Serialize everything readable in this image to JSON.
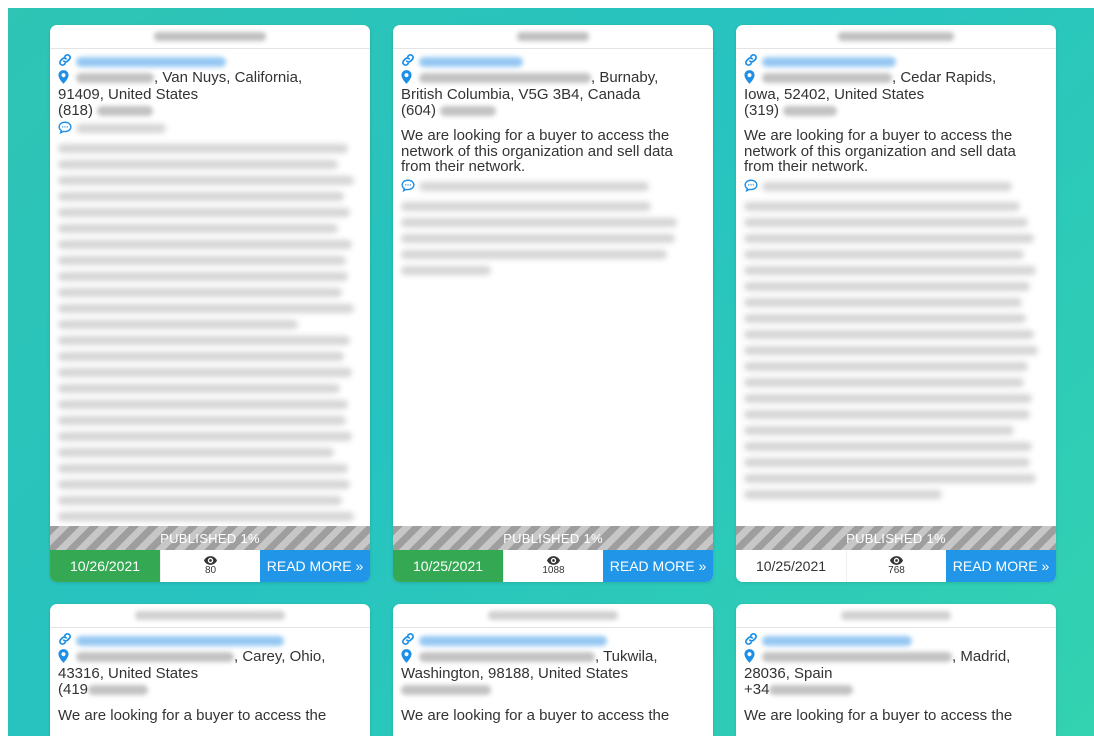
{
  "cards": [
    {
      "address_tail": ", Van Nuys, California,",
      "address_line2": "91409, United States",
      "phone_prefix": "(818)",
      "buyer_text": "",
      "status": "PUBLISHED 1%",
      "date": "10/26/2021",
      "views": "80",
      "read_more": "READ MORE »",
      "date_style": "green"
    },
    {
      "address_tail": ", Burnaby,",
      "address_line2": "British Columbia, V5G 3B4, Canada",
      "phone_prefix": "(604)",
      "buyer_text": "We are looking for a buyer to access the network of this organization and sell data from their network.",
      "status": "PUBLISHED 1%",
      "date": "10/25/2021",
      "views": "1088",
      "read_more": "READ MORE »",
      "date_style": "green"
    },
    {
      "address_tail": ", Cedar Rapids,",
      "address_line2": "Iowa, 52402, United States",
      "phone_prefix": "(319)",
      "buyer_text": "We are looking for a buyer to access the network of this organization and sell data from their network.",
      "status": "PUBLISHED 1%",
      "date": "10/25/2021",
      "views": "768",
      "read_more": "READ MORE »",
      "date_style": "plain"
    },
    {
      "address_tail": ", Carey, Ohio,",
      "address_line2": "43316, United States",
      "phone_prefix": "(419",
      "buyer_text": "We are looking for a buyer to access the"
    },
    {
      "address_tail": ", Tukwila,",
      "address_line2": "Washington, 98188, United States",
      "phone_prefix": "",
      "buyer_text": "We are looking for a buyer to access the"
    },
    {
      "address_tail": ", Madrid,",
      "address_line2": "28036, Spain",
      "phone_prefix": "+34",
      "buyer_text": "We are looking for a buyer to access the"
    }
  ],
  "icons": {
    "link": "link-icon",
    "location": "map-pin-icon",
    "comment": "comment-icon",
    "views": "eye-icon"
  },
  "colors": {
    "accent_blue": "#2196e8",
    "date_green": "#34a853",
    "background_teal": "#2fc4b4"
  }
}
